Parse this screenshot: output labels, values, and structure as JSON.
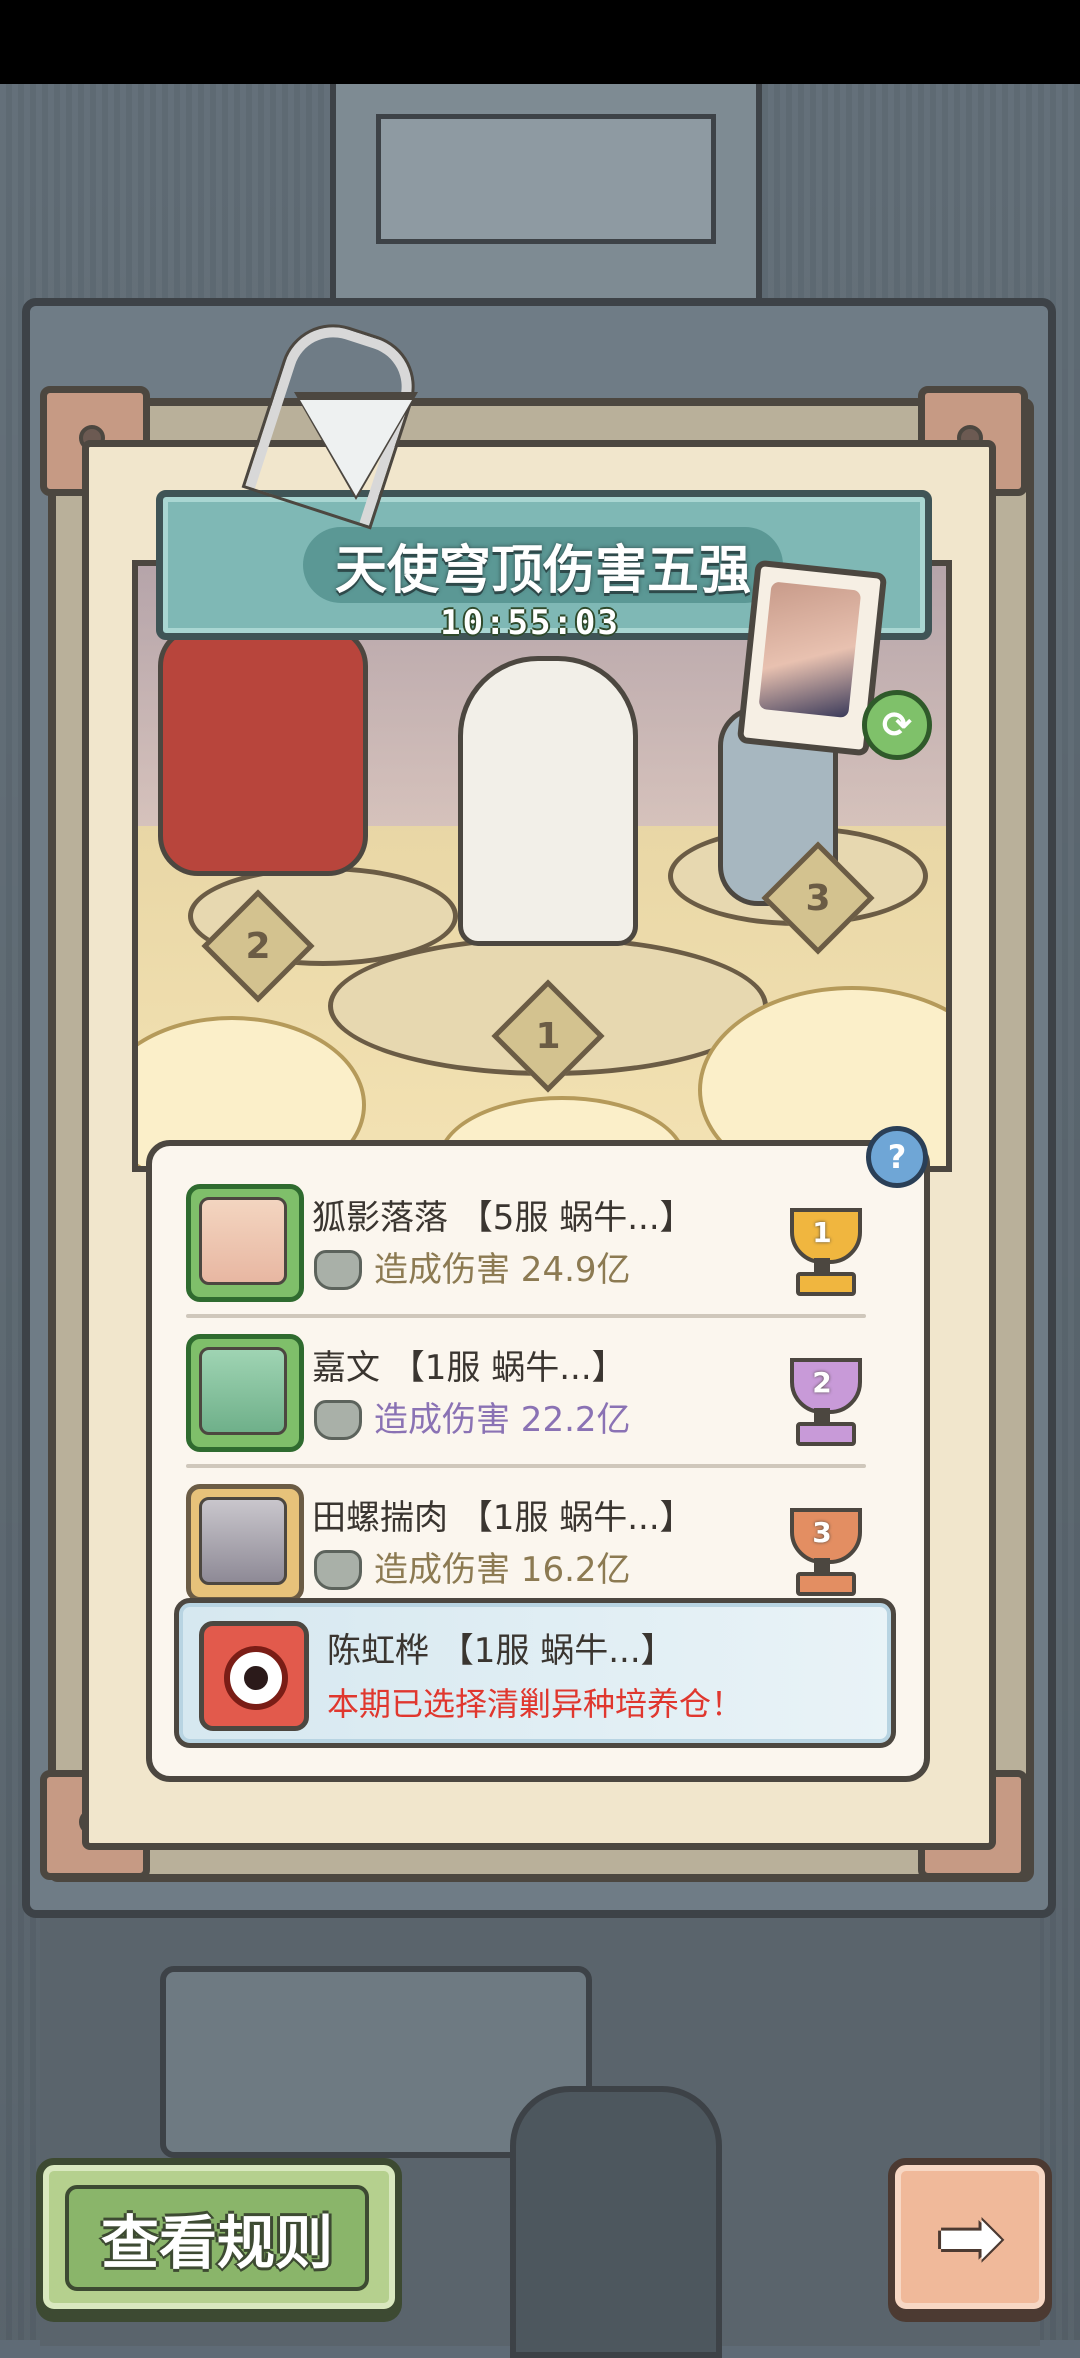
{
  "banner": {
    "title": "天使穹顶伤害五强",
    "timer": "10:55:03"
  },
  "podium": {
    "ranks": [
      "2",
      "1",
      "3"
    ]
  },
  "ranking": [
    {
      "name": "狐影落落 【5服 蜗牛...】",
      "damage": "造成伤害 24.9亿",
      "rank": "1",
      "accent": "#f0b63f"
    },
    {
      "name": "嘉文 【1服 蜗牛...】",
      "damage": "造成伤害 22.2亿",
      "rank": "2",
      "accent": "#c89ad8"
    },
    {
      "name": "田螺揣肉 【1服 蜗牛...】",
      "damage": "造成伤害 16.2亿",
      "rank": "3",
      "accent": "#e38e62"
    }
  ],
  "self": {
    "name": "陈虹桦 【1服 蜗牛...】",
    "note": "本期已选择清剿异种培养仓！"
  },
  "buttons": {
    "help": "?",
    "rules": "查看规则",
    "next": "➡",
    "swap": "⟳"
  },
  "icons": [
    "paperclip-icon",
    "triangle-logo-icon",
    "swap-icon",
    "help-icon",
    "damage-icon",
    "trophy-icon",
    "arrow-right-icon"
  ]
}
